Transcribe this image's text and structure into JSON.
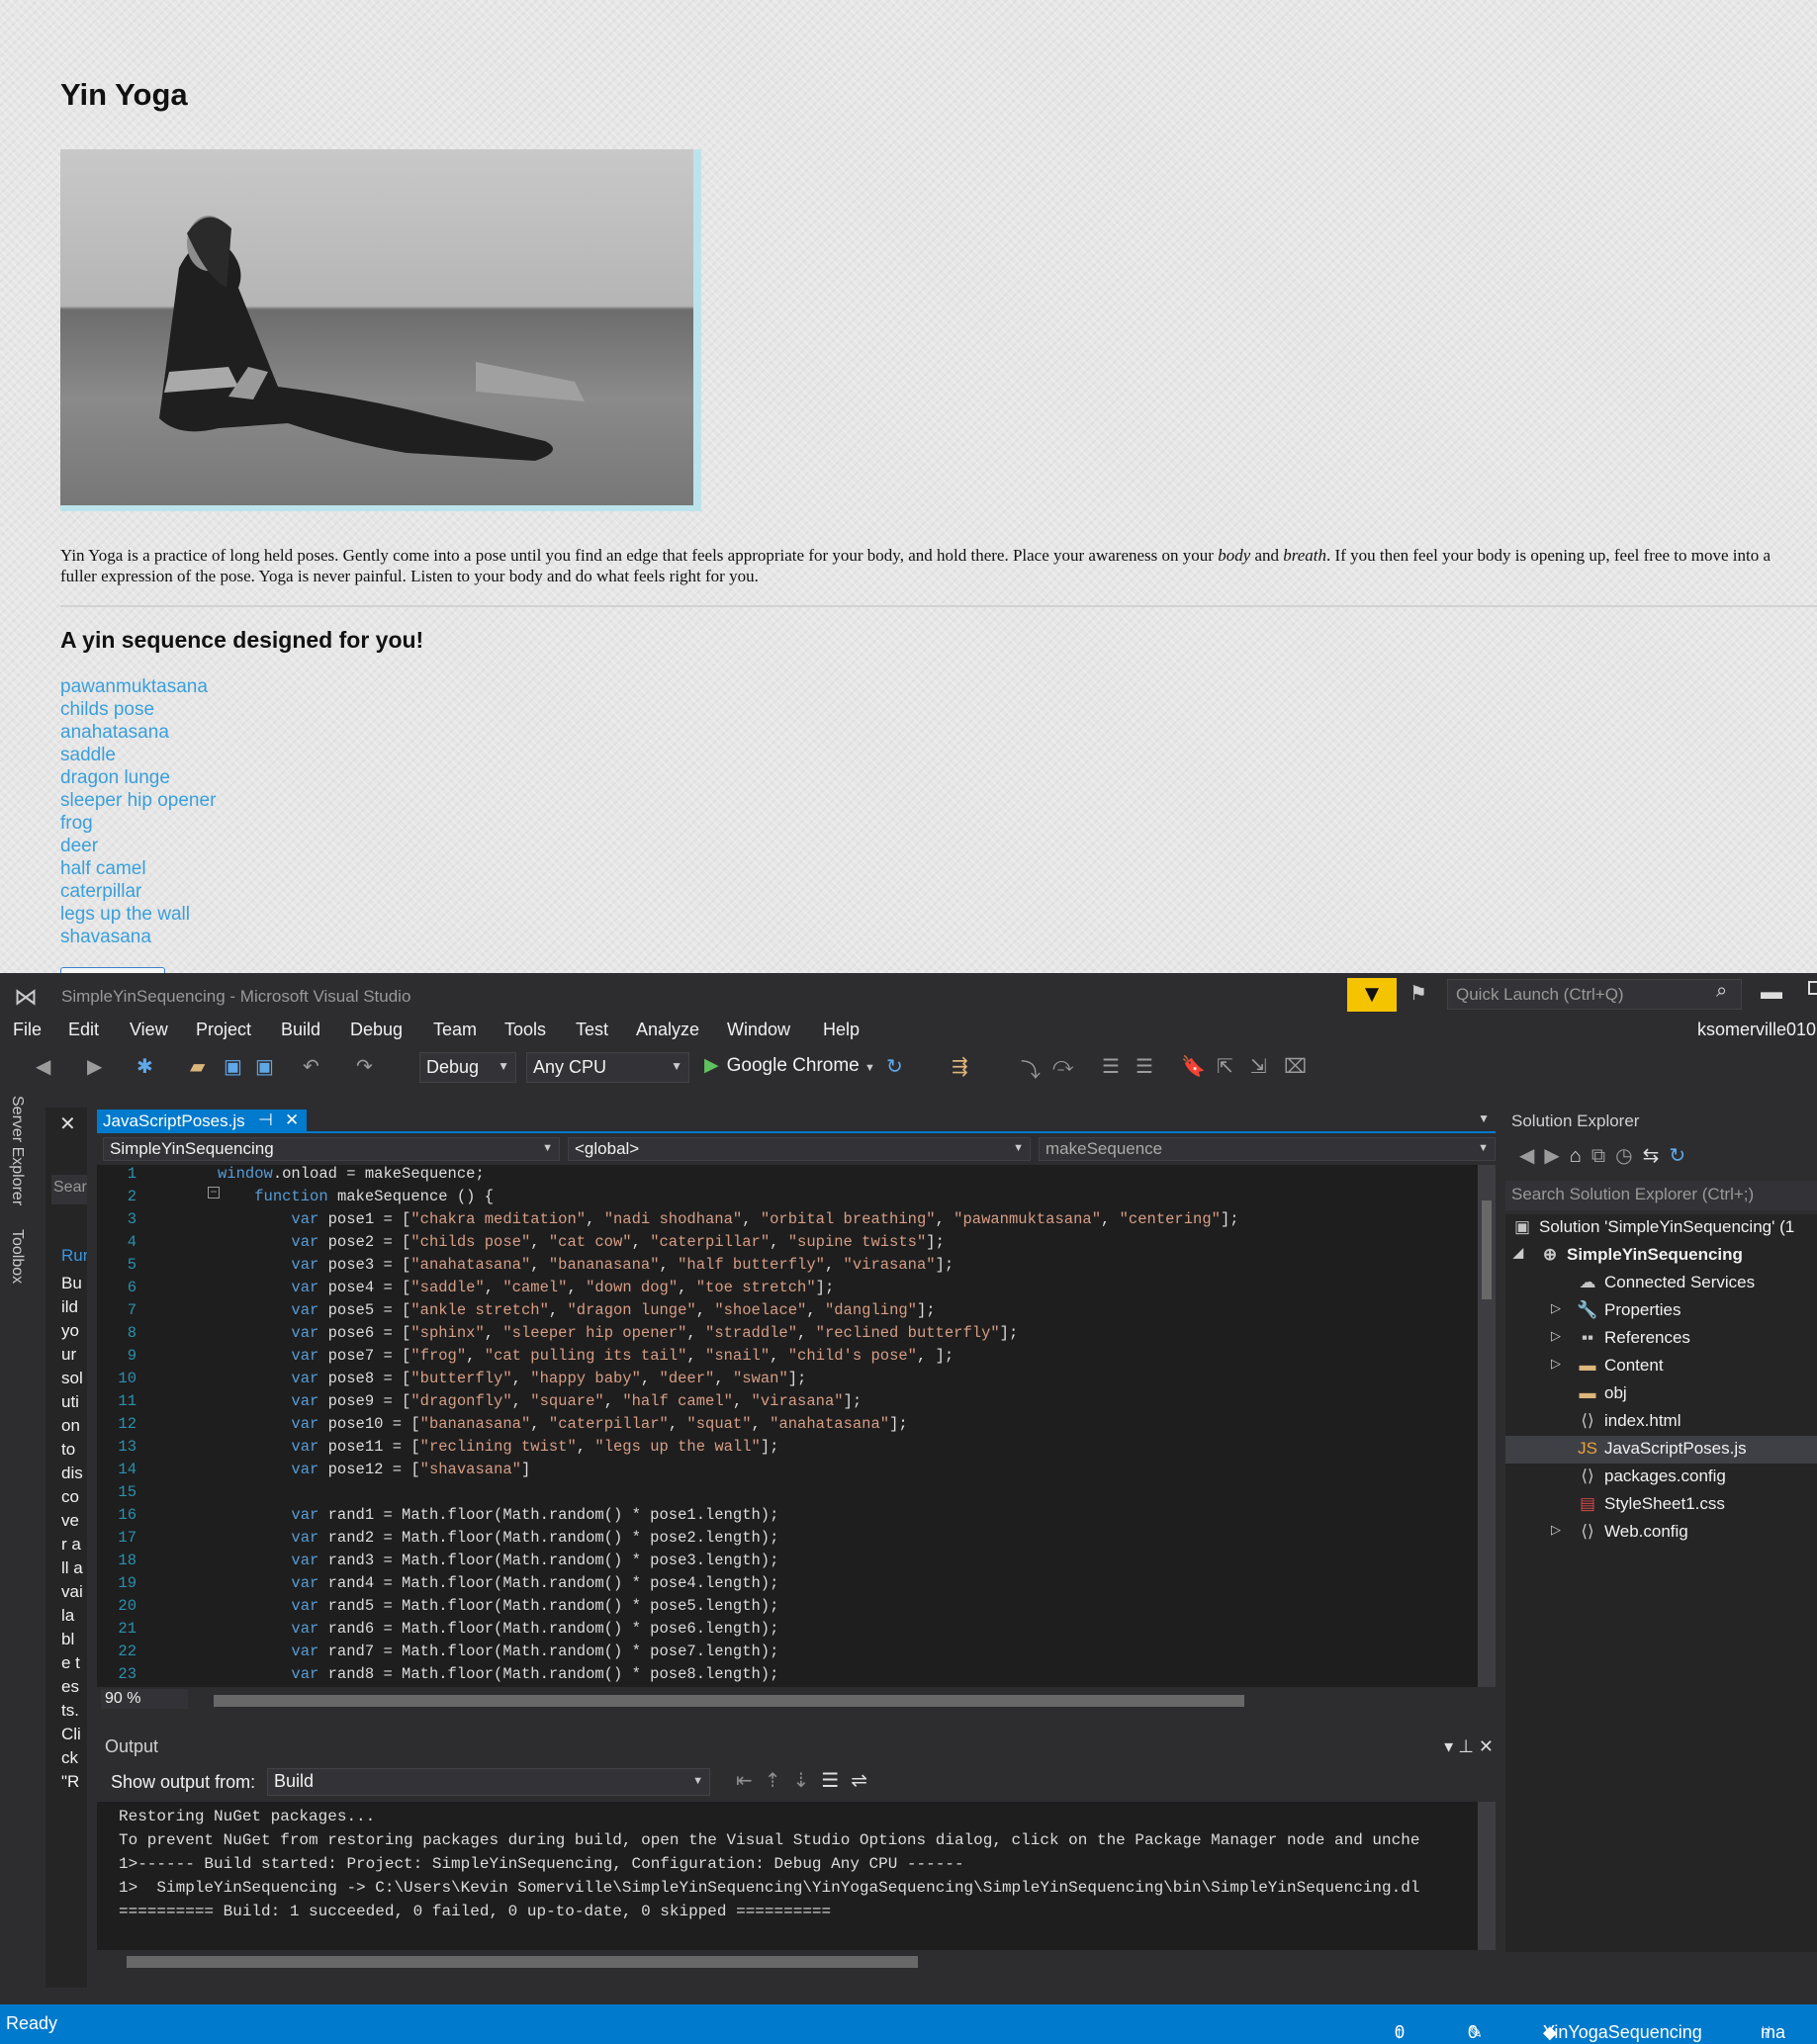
{
  "page": {
    "title": "Yin Yoga",
    "intro_a": "Yin Yoga is a practice of long held poses. Gently come into a pose until you find an edge that feels appropriate for your body, and hold there. Place your awareness on your ",
    "intro_body": "body",
    "intro_and": " and ",
    "intro_breath": "breath",
    "intro_b": ". If you then feel your body is opening up, feel free to move into a fuller expression of the pose. Yoga is never painful. Listen to your body and do what feels right for you.",
    "sequence_heading": "A yin sequence designed for you!",
    "poses": [
      "pawanmuktasana",
      "childs pose",
      "anahatasana",
      "saddle",
      "dragon lunge",
      "sleeper hip opener",
      "frog",
      "deer",
      "half camel",
      "caterpillar",
      "legs up the wall",
      "shavasana"
    ]
  },
  "vs": {
    "title": "SimpleYinSequencing - Microsoft Visual Studio",
    "quick_launch": "Quick Launch (Ctrl+Q)",
    "menu": [
      "File",
      "Edit",
      "View",
      "Project",
      "Build",
      "Debug",
      "Team",
      "Tools",
      "Test",
      "Analyze",
      "Window",
      "Help"
    ],
    "user": "ksomerville010",
    "toolbar": {
      "config": "Debug",
      "platform": "Any CPU",
      "run_target": "Google Chrome"
    },
    "left_tabs": [
      "Server Explorer",
      "Toolbox"
    ],
    "toolbox": {
      "search": "Sear",
      "run": "Run",
      "text": "Build your solution to discover all available tests. Click \"R"
    },
    "editor": {
      "tab": "JavaScriptPoses.js",
      "project": "SimpleYinSequencing",
      "scope": "<global>",
      "member": "makeSequence",
      "zoom": "90 %",
      "lines": [
        [
          [
            "kw",
            "window"
          ],
          [
            "",
            "."
          ],
          [
            "",
            "onload = makeSequence;"
          ]
        ],
        [
          [
            "",
            "    "
          ],
          [
            "kw",
            "function"
          ],
          [
            "",
            " makeSequence () {"
          ]
        ],
        [
          [
            "",
            "        "
          ],
          [
            "kw",
            "var"
          ],
          [
            "",
            " pose1 = ["
          ],
          [
            "st",
            "\"chakra meditation\""
          ],
          [
            "",
            ", "
          ],
          [
            "st",
            "\"nadi shodhana\""
          ],
          [
            "",
            ", "
          ],
          [
            "st",
            "\"orbital breathing\""
          ],
          [
            "",
            ", "
          ],
          [
            "st",
            "\"pawanmuktasana\""
          ],
          [
            "",
            ", "
          ],
          [
            "st",
            "\"centering\""
          ],
          [
            "",
            "];"
          ]
        ],
        [
          [
            "",
            "        "
          ],
          [
            "kw",
            "var"
          ],
          [
            "",
            " pose2 = ["
          ],
          [
            "st",
            "\"childs pose\""
          ],
          [
            "",
            ", "
          ],
          [
            "st",
            "\"cat cow\""
          ],
          [
            "",
            ", "
          ],
          [
            "st",
            "\"caterpillar\""
          ],
          [
            "",
            ", "
          ],
          [
            "st",
            "\"supine twists\""
          ],
          [
            "",
            "];"
          ]
        ],
        [
          [
            "",
            "        "
          ],
          [
            "kw",
            "var"
          ],
          [
            "",
            " pose3 = ["
          ],
          [
            "st",
            "\"anahatasana\""
          ],
          [
            "",
            ", "
          ],
          [
            "st",
            "\"bananasana\""
          ],
          [
            "",
            ", "
          ],
          [
            "st",
            "\"half butterfly\""
          ],
          [
            "",
            ", "
          ],
          [
            "st",
            "\"virasana\""
          ],
          [
            "",
            "];"
          ]
        ],
        [
          [
            "",
            "        "
          ],
          [
            "kw",
            "var"
          ],
          [
            "",
            " pose4 = ["
          ],
          [
            "st",
            "\"saddle\""
          ],
          [
            "",
            ", "
          ],
          [
            "st",
            "\"camel\""
          ],
          [
            "",
            ", "
          ],
          [
            "st",
            "\"down dog\""
          ],
          [
            "",
            ", "
          ],
          [
            "st",
            "\"toe stretch\""
          ],
          [
            "",
            "];"
          ]
        ],
        [
          [
            "",
            "        "
          ],
          [
            "kw",
            "var"
          ],
          [
            "",
            " pose5 = ["
          ],
          [
            "st",
            "\"ankle stretch\""
          ],
          [
            "",
            ", "
          ],
          [
            "st",
            "\"dragon lunge\""
          ],
          [
            "",
            ", "
          ],
          [
            "st",
            "\"shoelace\""
          ],
          [
            "",
            ", "
          ],
          [
            "st",
            "\"dangling\""
          ],
          [
            "",
            "];"
          ]
        ],
        [
          [
            "",
            "        "
          ],
          [
            "kw",
            "var"
          ],
          [
            "",
            " pose6 = ["
          ],
          [
            "st",
            "\"sphinx\""
          ],
          [
            "",
            ", "
          ],
          [
            "st",
            "\"sleeper hip opener\""
          ],
          [
            "",
            ", "
          ],
          [
            "st",
            "\"straddle\""
          ],
          [
            "",
            ", "
          ],
          [
            "st",
            "\"reclined butterfly\""
          ],
          [
            "",
            "];"
          ]
        ],
        [
          [
            "",
            "        "
          ],
          [
            "kw",
            "var"
          ],
          [
            "",
            " pose7 = ["
          ],
          [
            "st",
            "\"frog\""
          ],
          [
            "",
            ", "
          ],
          [
            "st",
            "\"cat pulling its tail\""
          ],
          [
            "",
            ", "
          ],
          [
            "st",
            "\"snail\""
          ],
          [
            "",
            ", "
          ],
          [
            "st",
            "\"child's pose\""
          ],
          [
            "",
            ", ];"
          ]
        ],
        [
          [
            "",
            "        "
          ],
          [
            "kw",
            "var"
          ],
          [
            "",
            " pose8 = ["
          ],
          [
            "st",
            "\"butterfly\""
          ],
          [
            "",
            ", "
          ],
          [
            "st",
            "\"happy baby\""
          ],
          [
            "",
            ", "
          ],
          [
            "st",
            "\"deer\""
          ],
          [
            "",
            ", "
          ],
          [
            "st",
            "\"swan\""
          ],
          [
            "",
            "];"
          ]
        ],
        [
          [
            "",
            "        "
          ],
          [
            "kw",
            "var"
          ],
          [
            "",
            " pose9 = ["
          ],
          [
            "st",
            "\"dragonfly\""
          ],
          [
            "",
            ", "
          ],
          [
            "st",
            "\"square\""
          ],
          [
            "",
            ", "
          ],
          [
            "st",
            "\"half camel\""
          ],
          [
            "",
            ", "
          ],
          [
            "st",
            "\"virasana\""
          ],
          [
            "",
            "];"
          ]
        ],
        [
          [
            "",
            "        "
          ],
          [
            "kw",
            "var"
          ],
          [
            "",
            " pose10 = ["
          ],
          [
            "st",
            "\"bananasana\""
          ],
          [
            "",
            ", "
          ],
          [
            "st",
            "\"caterpillar\""
          ],
          [
            "",
            ", "
          ],
          [
            "st",
            "\"squat\""
          ],
          [
            "",
            ", "
          ],
          [
            "st",
            "\"anahatasana\""
          ],
          [
            "",
            "];"
          ]
        ],
        [
          [
            "",
            "        "
          ],
          [
            "kw",
            "var"
          ],
          [
            "",
            " pose11 = ["
          ],
          [
            "st",
            "\"reclining twist\""
          ],
          [
            "",
            ", "
          ],
          [
            "st",
            "\"legs up the wall\""
          ],
          [
            "",
            "];"
          ]
        ],
        [
          [
            "",
            "        "
          ],
          [
            "kw",
            "var"
          ],
          [
            "",
            " pose12 = ["
          ],
          [
            "st",
            "\"shavasana\""
          ],
          [
            "",
            "]"
          ]
        ],
        [
          [
            "",
            ""
          ]
        ],
        [
          [
            "",
            "        "
          ],
          [
            "kw",
            "var"
          ],
          [
            "",
            " rand1 = Math.floor(Math.random() * pose1.length);"
          ]
        ],
        [
          [
            "",
            "        "
          ],
          [
            "kw",
            "var"
          ],
          [
            "",
            " rand2 = Math.floor(Math.random() * pose2.length);"
          ]
        ],
        [
          [
            "",
            "        "
          ],
          [
            "kw",
            "var"
          ],
          [
            "",
            " rand3 = Math.floor(Math.random() * pose3.length);"
          ]
        ],
        [
          [
            "",
            "        "
          ],
          [
            "kw",
            "var"
          ],
          [
            "",
            " rand4 = Math.floor(Math.random() * pose4.length);"
          ]
        ],
        [
          [
            "",
            "        "
          ],
          [
            "kw",
            "var"
          ],
          [
            "",
            " rand5 = Math.floor(Math.random() * pose5.length);"
          ]
        ],
        [
          [
            "",
            "        "
          ],
          [
            "kw",
            "var"
          ],
          [
            "",
            " rand6 = Math.floor(Math.random() * pose6.length);"
          ]
        ],
        [
          [
            "",
            "        "
          ],
          [
            "kw",
            "var"
          ],
          [
            "",
            " rand7 = Math.floor(Math.random() * pose7.length);"
          ]
        ],
        [
          [
            "",
            "        "
          ],
          [
            "kw",
            "var"
          ],
          [
            "",
            " rand8 = Math.floor(Math.random() * pose8.length);"
          ]
        ]
      ]
    },
    "output": {
      "title": "Output",
      "show_from_label": "Show output from:",
      "source": "Build",
      "lines": [
        "Restoring NuGet packages...",
        "To prevent NuGet from restoring packages during build, open the Visual Studio Options dialog, click on the Package Manager node and unche",
        "1>------ Build started: Project: SimpleYinSequencing, Configuration: Debug Any CPU ------",
        "1>  SimpleYinSequencing -> C:\\Users\\Kevin Somerville\\SimpleYinSequencing\\YinYogaSequencing\\SimpleYinSequencing\\bin\\SimpleYinSequencing.dl",
        "========== Build: 1 succeeded, 0 failed, 0 up-to-date, 0 skipped =========="
      ]
    },
    "solution_explorer": {
      "title": "Solution Explorer",
      "search": "Search Solution Explorer (Ctrl+;)",
      "items": [
        "Solution 'SimpleYinSequencing' (1",
        "SimpleYinSequencing",
        "Connected Services",
        "Properties",
        "References",
        "Content",
        "obj",
        "index.html",
        "JavaScriptPoses.js",
        "packages.config",
        "StyleSheet1.css",
        "Web.config"
      ]
    },
    "status": {
      "ready": "Ready",
      "up_count": "0",
      "edit_count": "0",
      "repo": "YinYogaSequencing",
      "branch": "ma"
    }
  }
}
